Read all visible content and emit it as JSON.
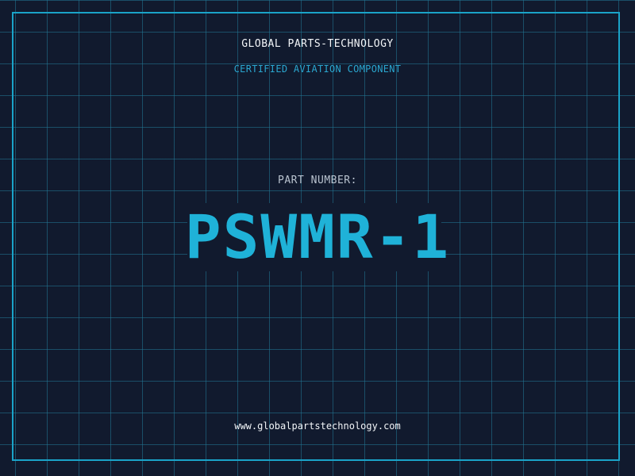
{
  "header": {
    "brand": "GLOBAL PARTS-TECHNOLOGY",
    "tagline": "CERTIFIED AVIATION COMPONENT"
  },
  "part": {
    "label": "PART NUMBER:",
    "number": "PSWMR-1"
  },
  "footer": {
    "website": "www.globalpartstechnology.com"
  },
  "colors": {
    "background": "#111a2e",
    "grid": "#227896",
    "frame": "#1aa3c8",
    "accent": "#1fb2d8",
    "text": "#f2f5f8",
    "muted": "#b9c3cf"
  }
}
